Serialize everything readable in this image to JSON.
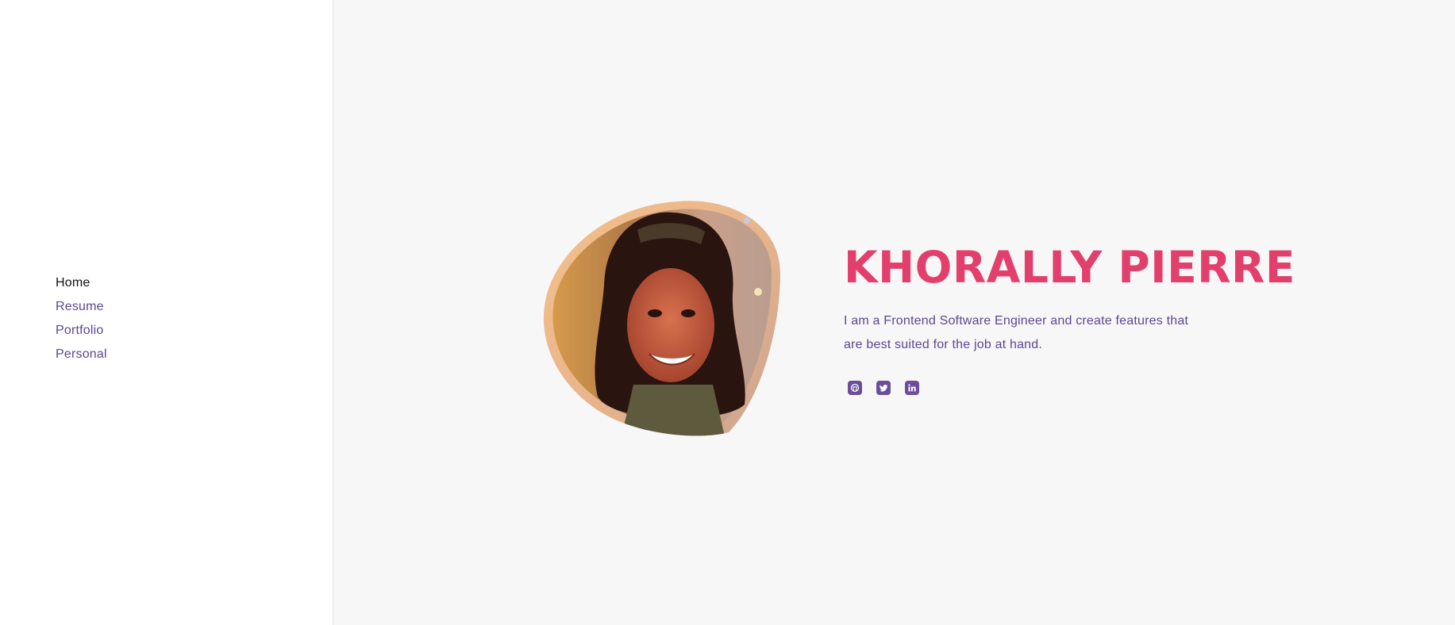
{
  "sidebar": {
    "items": [
      {
        "label": "Home",
        "active": true
      },
      {
        "label": "Resume",
        "active": false
      },
      {
        "label": "Portfolio",
        "active": false
      },
      {
        "label": "Personal",
        "active": false
      }
    ]
  },
  "hero": {
    "name": "KHORALLY PIERRE",
    "bio": "I am a Frontend Software Engineer and create features that are best suited for the job at hand.",
    "portrait_icon": "profile-photo",
    "socials": [
      {
        "icon": "github-icon"
      },
      {
        "icon": "twitter-icon"
      },
      {
        "icon": "linkedin-icon"
      }
    ]
  },
  "colors": {
    "accent": "#e23f6c",
    "primary": "#5c4690",
    "icon_bg": "#6b4d9a",
    "active_nav": "#111111",
    "background": "#f8f7f7",
    "sidebar_bg": "#ffffff"
  }
}
